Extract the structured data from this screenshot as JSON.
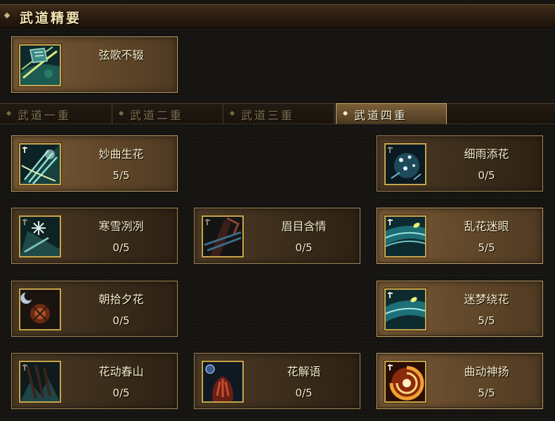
{
  "header": {
    "title": "武道精要"
  },
  "essence": {
    "name": "弦歌不辍",
    "icon": "wind-scroll-icon"
  },
  "tabs": [
    {
      "label": "武道一重",
      "active": false
    },
    {
      "label": "武道二重",
      "active": false
    },
    {
      "label": "武道三重",
      "active": false
    },
    {
      "label": "武道四重",
      "active": true
    }
  ],
  "skills": {
    "miaoqu": {
      "name": "妙曲生花",
      "level": "5/5",
      "icon": "pipa-strings-icon"
    },
    "xiyu": {
      "name": "细雨添花",
      "level": "0/5",
      "icon": "rain-petals-icon"
    },
    "hanxue": {
      "name": "寒雪冽冽",
      "level": "0/5",
      "icon": "snow-flower-icon"
    },
    "meimu": {
      "name": "眉目含情",
      "level": "0/5",
      "icon": "fan-glance-icon"
    },
    "luanhua": {
      "name": "乱花迷眼",
      "level": "5/5",
      "icon": "flower-storm-icon"
    },
    "zhaoshi": {
      "name": "朝拾夕花",
      "level": "0/5",
      "icon": "moon-flower-icon"
    },
    "mimeng": {
      "name": "迷梦绕花",
      "level": "5/5",
      "icon": "dream-flower-icon"
    },
    "huadong": {
      "name": "花动春山",
      "level": "0/5",
      "icon": "spring-mountain-icon"
    },
    "huajie": {
      "name": "花解语",
      "level": "0/5",
      "icon": "flower-speech-icon"
    },
    "qudong": {
      "name": "曲动神扬",
      "level": "5/5",
      "icon": "fire-vortex-icon"
    }
  }
}
